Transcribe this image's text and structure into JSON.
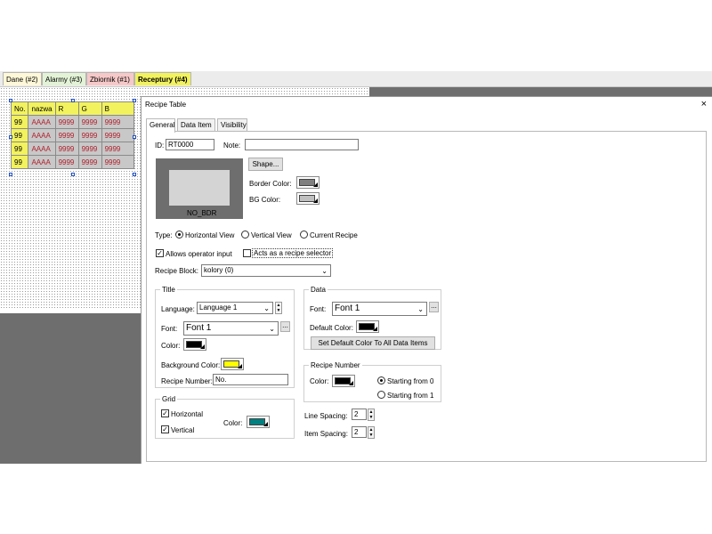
{
  "page_tabs": [
    {
      "label": "Dane (#2)",
      "color": "#fff8d8"
    },
    {
      "label": "Alarmy (#3)",
      "color": "#e3f3d6"
    },
    {
      "label": "Zbiornik (#1)",
      "color": "#f6c8c8"
    },
    {
      "label": "Receptury (#4)",
      "color": "#f2f25e"
    }
  ],
  "recipe_table": {
    "headers": [
      "No.",
      "nazwa",
      "R",
      "G",
      "B"
    ],
    "rows": [
      [
        "99",
        "AAAA",
        "9999",
        "9999",
        "9999"
      ],
      [
        "99",
        "AAAA",
        "9999",
        "9999",
        "9999"
      ],
      [
        "99",
        "AAAA",
        "9999",
        "9999",
        "9999"
      ],
      [
        "99",
        "AAAA",
        "9999",
        "9999",
        "9999"
      ]
    ]
  },
  "dialog": {
    "title": "Recipe Table",
    "close": "×",
    "tabs": [
      "General",
      "Data Item",
      "Visibility"
    ],
    "id_label": "ID:",
    "id_value": "RT0000",
    "note_label": "Note:",
    "note_value": "",
    "preview_label": "NO_BDR",
    "shape_button": "Shape...",
    "border_color_label": "Border Color:",
    "bg_color_label": "BG Color:",
    "type_label": "Type:",
    "type_options": [
      "Horizontal View",
      "Vertical View",
      "Current Recipe"
    ],
    "allows_operator_input": "Allows operator input",
    "acts_as_selector": "Acts as a recipe selector",
    "recipe_block_label": "Recipe Block:",
    "recipe_block_value": "kolory (0)",
    "title_group": {
      "label": "Title",
      "language_label": "Language:",
      "language_value": "Language 1",
      "font_label": "Font:",
      "font_value": "Font 1",
      "color_label": "Color:",
      "bg_color_label": "Background Color:",
      "recipe_number_label": "Recipe Number:",
      "recipe_number_value": "No."
    },
    "grid_group": {
      "label": "Grid",
      "horizontal": "Horizontal",
      "vertical": "Vertical",
      "color_label": "Color:"
    },
    "data_group": {
      "label": "Data",
      "font_label": "Font:",
      "font_value": "Font 1",
      "default_color_label": "Default Color:",
      "set_default_button": "Set Default Color To All Data Items"
    },
    "recipe_number_group": {
      "label": "Recipe Number",
      "color_label": "Color:",
      "start0": "Starting from 0",
      "start1": "Starting from 1"
    },
    "line_spacing_label": "Line Spacing:",
    "line_spacing_value": "2",
    "item_spacing_label": "Item Spacing:",
    "item_spacing_value": "2",
    "ellipsis": "...",
    "check_mark": "✓",
    "spin_up": "▲",
    "spin_down": "▼",
    "combo_arrow": "⌄",
    "colors": {
      "border": "#808080",
      "bg": "#c0c0c0",
      "title_text": "#000000",
      "title_background": "#ffff00",
      "grid": "#008080",
      "data_default": "#000000",
      "recipe_number": "#000000",
      "preview_outer": "#6e6e6e",
      "preview_inner": "#d4d4d4"
    }
  }
}
